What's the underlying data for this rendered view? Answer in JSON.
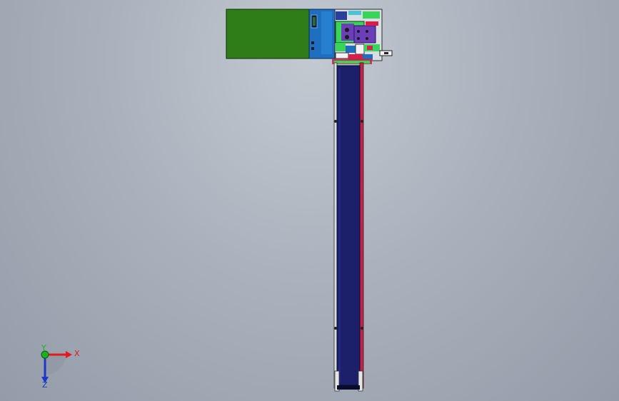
{
  "viewport": {
    "view_type": "3D CAD model viewport",
    "colors": {
      "background_top": "#c2c9d1",
      "background_bottom": "#939ca8",
      "enclosure_green": "#2f7d18",
      "panel_blue": "#1f6fc0",
      "belt_navy": "#1c1f6a",
      "frame_red": "#c0264a",
      "accent_green": "#3bd45b",
      "accent_purple": "#6b3fb8",
      "axis_x": "#e8171b",
      "axis_y": "#1bb21b",
      "axis_z": "#1d36c8"
    }
  },
  "model": {
    "parts": [
      {
        "name": "green-enclosure",
        "color": "#2f7d18"
      },
      {
        "name": "blue-control-panel",
        "color": "#1f6fc0"
      },
      {
        "name": "mechanism-assembly",
        "color": "#3bd45b"
      },
      {
        "name": "conveyor-belt",
        "color": "#1c1f6a"
      }
    ]
  },
  "triad": {
    "x_label": "X",
    "y_label": "Y",
    "z_label": "Z"
  }
}
